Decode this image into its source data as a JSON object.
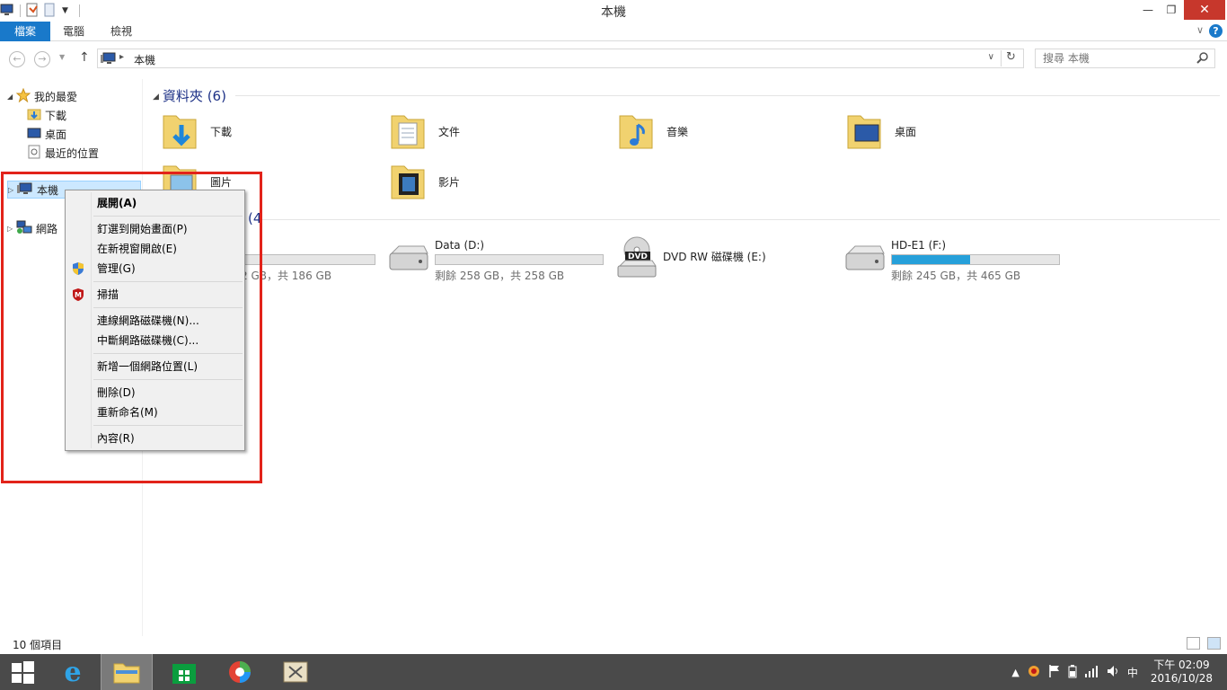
{
  "window": {
    "title": "本機"
  },
  "ribbon": {
    "file_tab": "檔案",
    "tabs": [
      "電腦",
      "檢視"
    ],
    "help": "?"
  },
  "address": {
    "path": "本機",
    "search_placeholder": "搜尋 本機"
  },
  "nav": {
    "favorites_label": "我的最愛",
    "favorites": [
      "下載",
      "桌面",
      "最近的位置"
    ],
    "this_pc": "本機",
    "network": "網路"
  },
  "folders_section": {
    "header": "資料夾 (6)",
    "items": [
      "下載",
      "文件",
      "音樂",
      "桌面",
      "圖片",
      "影片"
    ]
  },
  "devices_section": {
    "header_partial": "(4",
    "drives": [
      {
        "name": "",
        "info": "2 GB，共 186 GB",
        "used_fraction": null
      },
      {
        "name": "Data (D:)",
        "info": "剩餘 258 GB，共 258 GB",
        "used_fraction": 0.0
      },
      {
        "name": "DVD RW 磁碟機 (E:)",
        "info": "",
        "used_fraction": null
      },
      {
        "name": "HD-E1 (F:)",
        "info": "剩餘 245 GB，共 465 GB",
        "used_fraction": 0.47
      }
    ]
  },
  "context_menu": {
    "items": [
      "展開(A)",
      "釘選到開始畫面(P)",
      "在新視窗開啟(E)",
      "管理(G)",
      "掃描",
      "連線網路磁碟機(N)...",
      "中斷網路磁碟機(C)...",
      "新增一個網路位置(L)",
      "刪除(D)",
      "重新命名(M)",
      "內容(R)"
    ]
  },
  "status": {
    "count": "10 個項目"
  },
  "taskbar": {
    "ime": "中",
    "time": "下午 02:09",
    "date": "2016/10/28"
  },
  "colors": {
    "accent": "#1979ca",
    "highlight_border": "#e2231a",
    "drive_fill": "#26a0da"
  }
}
